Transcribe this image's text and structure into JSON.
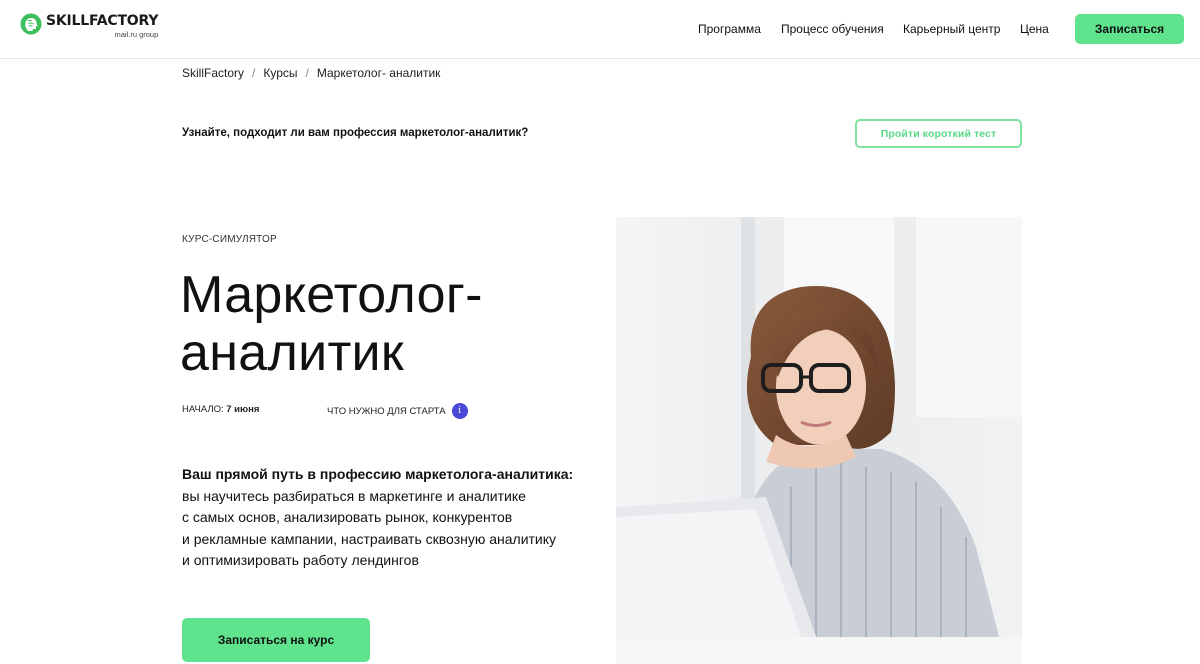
{
  "header": {
    "logo_name": "SKILLFACTORY",
    "logo_sub": "mail.ru group",
    "nav": [
      "Программа",
      "Процесс обучения",
      "Карьерный центр",
      "Цена"
    ],
    "cta_label": "Записаться"
  },
  "breadcrumb": [
    "SkillFactory",
    "Курсы",
    "Маркетолог- аналитик"
  ],
  "quiz": {
    "question": "Узнайте, подходит ли вам профессия маркетолог-аналитик?",
    "button_label": "Пройти короткий тест"
  },
  "hero": {
    "eyebrow": "КУРС-СИМУЛЯТОР",
    "title_line1": "Маркетолог-",
    "title_line2": "аналитик",
    "start_label": "НАЧАЛО:",
    "start_value": "7 июня",
    "requirements_label": "ЧТО НУЖНО ДЛЯ СТАРТА",
    "info_icon": "i",
    "description_lead": "Ваш прямой путь в профессию маркетолога-аналитика:",
    "description_lines": [
      "вы научитесь разбираться в маркетинге и аналитике",
      "с самых основ, анализировать рынок, конкурентов",
      "и рекламные кампании, настраивать сквозную аналитику",
      "и оптимизировать работу лендингов"
    ],
    "cta_label": "Записаться на курс"
  },
  "colors": {
    "accent_green": "#5fe38d",
    "outline_green": "#7fe2a3",
    "info_blue": "#4a48d8"
  },
  "icons": {
    "logo": "brain-head-icon",
    "info": "info-icon"
  }
}
